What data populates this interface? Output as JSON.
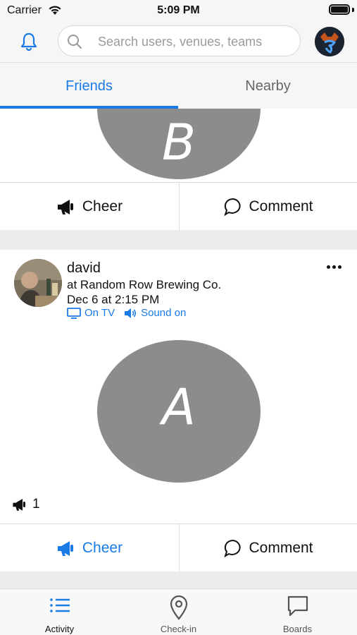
{
  "status_bar": {
    "carrier": "Carrier",
    "time": "5:09 PM"
  },
  "header": {
    "bell_icon": "bell-icon",
    "search_placeholder": "Search users, venues, teams",
    "search_value": ""
  },
  "tabs": [
    {
      "label": "Friends",
      "active": true
    },
    {
      "label": "Nearby",
      "active": false
    }
  ],
  "posts": [
    {
      "avatar_letter": "B",
      "actions": {
        "cheer_label": "Cheer",
        "comment_label": "Comment",
        "cheer_active": false
      }
    },
    {
      "user": "david",
      "venue": "at Random Row Brewing Co.",
      "date": "Dec 6 at 2:15 PM",
      "tags": [
        {
          "icon": "tv-icon",
          "label": "On TV"
        },
        {
          "icon": "speaker-icon",
          "label": "Sound on"
        }
      ],
      "avatar_letter": "A",
      "cheer_count": "1",
      "actions": {
        "cheer_label": "Cheer",
        "comment_label": "Comment",
        "cheer_active": true
      }
    }
  ],
  "bottom_nav": [
    {
      "label": "Activity",
      "icon": "list-icon",
      "active": true
    },
    {
      "label": "Check-in",
      "icon": "map-pin-icon",
      "active": false
    },
    {
      "label": "Boards",
      "icon": "chat-bubble-icon",
      "active": false
    }
  ],
  "colors": {
    "accent": "#1a7ae6",
    "circle_gray": "#8c8c8c",
    "feed_background": "#ececec"
  }
}
